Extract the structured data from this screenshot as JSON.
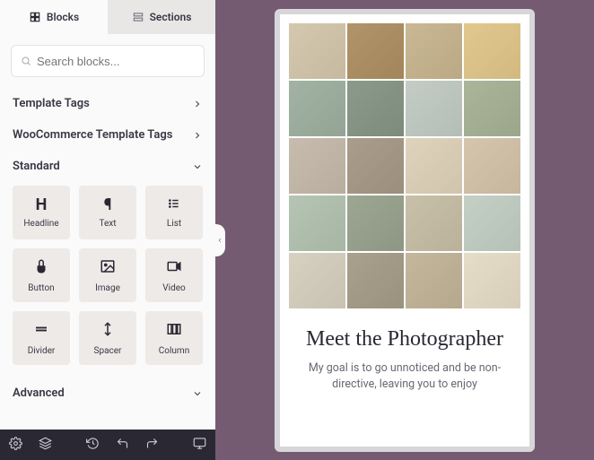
{
  "tabs": {
    "blocks": "Blocks",
    "sections": "Sections"
  },
  "search": {
    "placeholder": "Search blocks..."
  },
  "sections": {
    "template_tags": "Template Tags",
    "woo_tags": "WooCommerce Template Tags",
    "standard": "Standard",
    "advanced": "Advanced"
  },
  "blocks": {
    "headline": "Headline",
    "text": "Text",
    "list": "List",
    "button": "Button",
    "image": "Image",
    "video": "Video",
    "divider": "Divider",
    "spacer": "Spacer",
    "column": "Column"
  },
  "preview": {
    "heading": "Meet the Photographer",
    "body": "My goal is to go unnoticed and be non-directive, leaving you to enjoy"
  },
  "gallery_colors": [
    "#d4c8ae",
    "#b2946a",
    "#c9b893",
    "#e0c88f",
    "#a3b3a3",
    "#8b9a8a",
    "#c3ccc5",
    "#aab59a",
    "#c7bcae",
    "#aa9d8b",
    "#e0d3bb",
    "#d5c5ad",
    "#b6c5b3",
    "#9da693",
    "#c8c0a8",
    "#c4d0c6",
    "#d7d1c2",
    "#a9a08d",
    "#c4b79c",
    "#e6ddc9"
  ]
}
